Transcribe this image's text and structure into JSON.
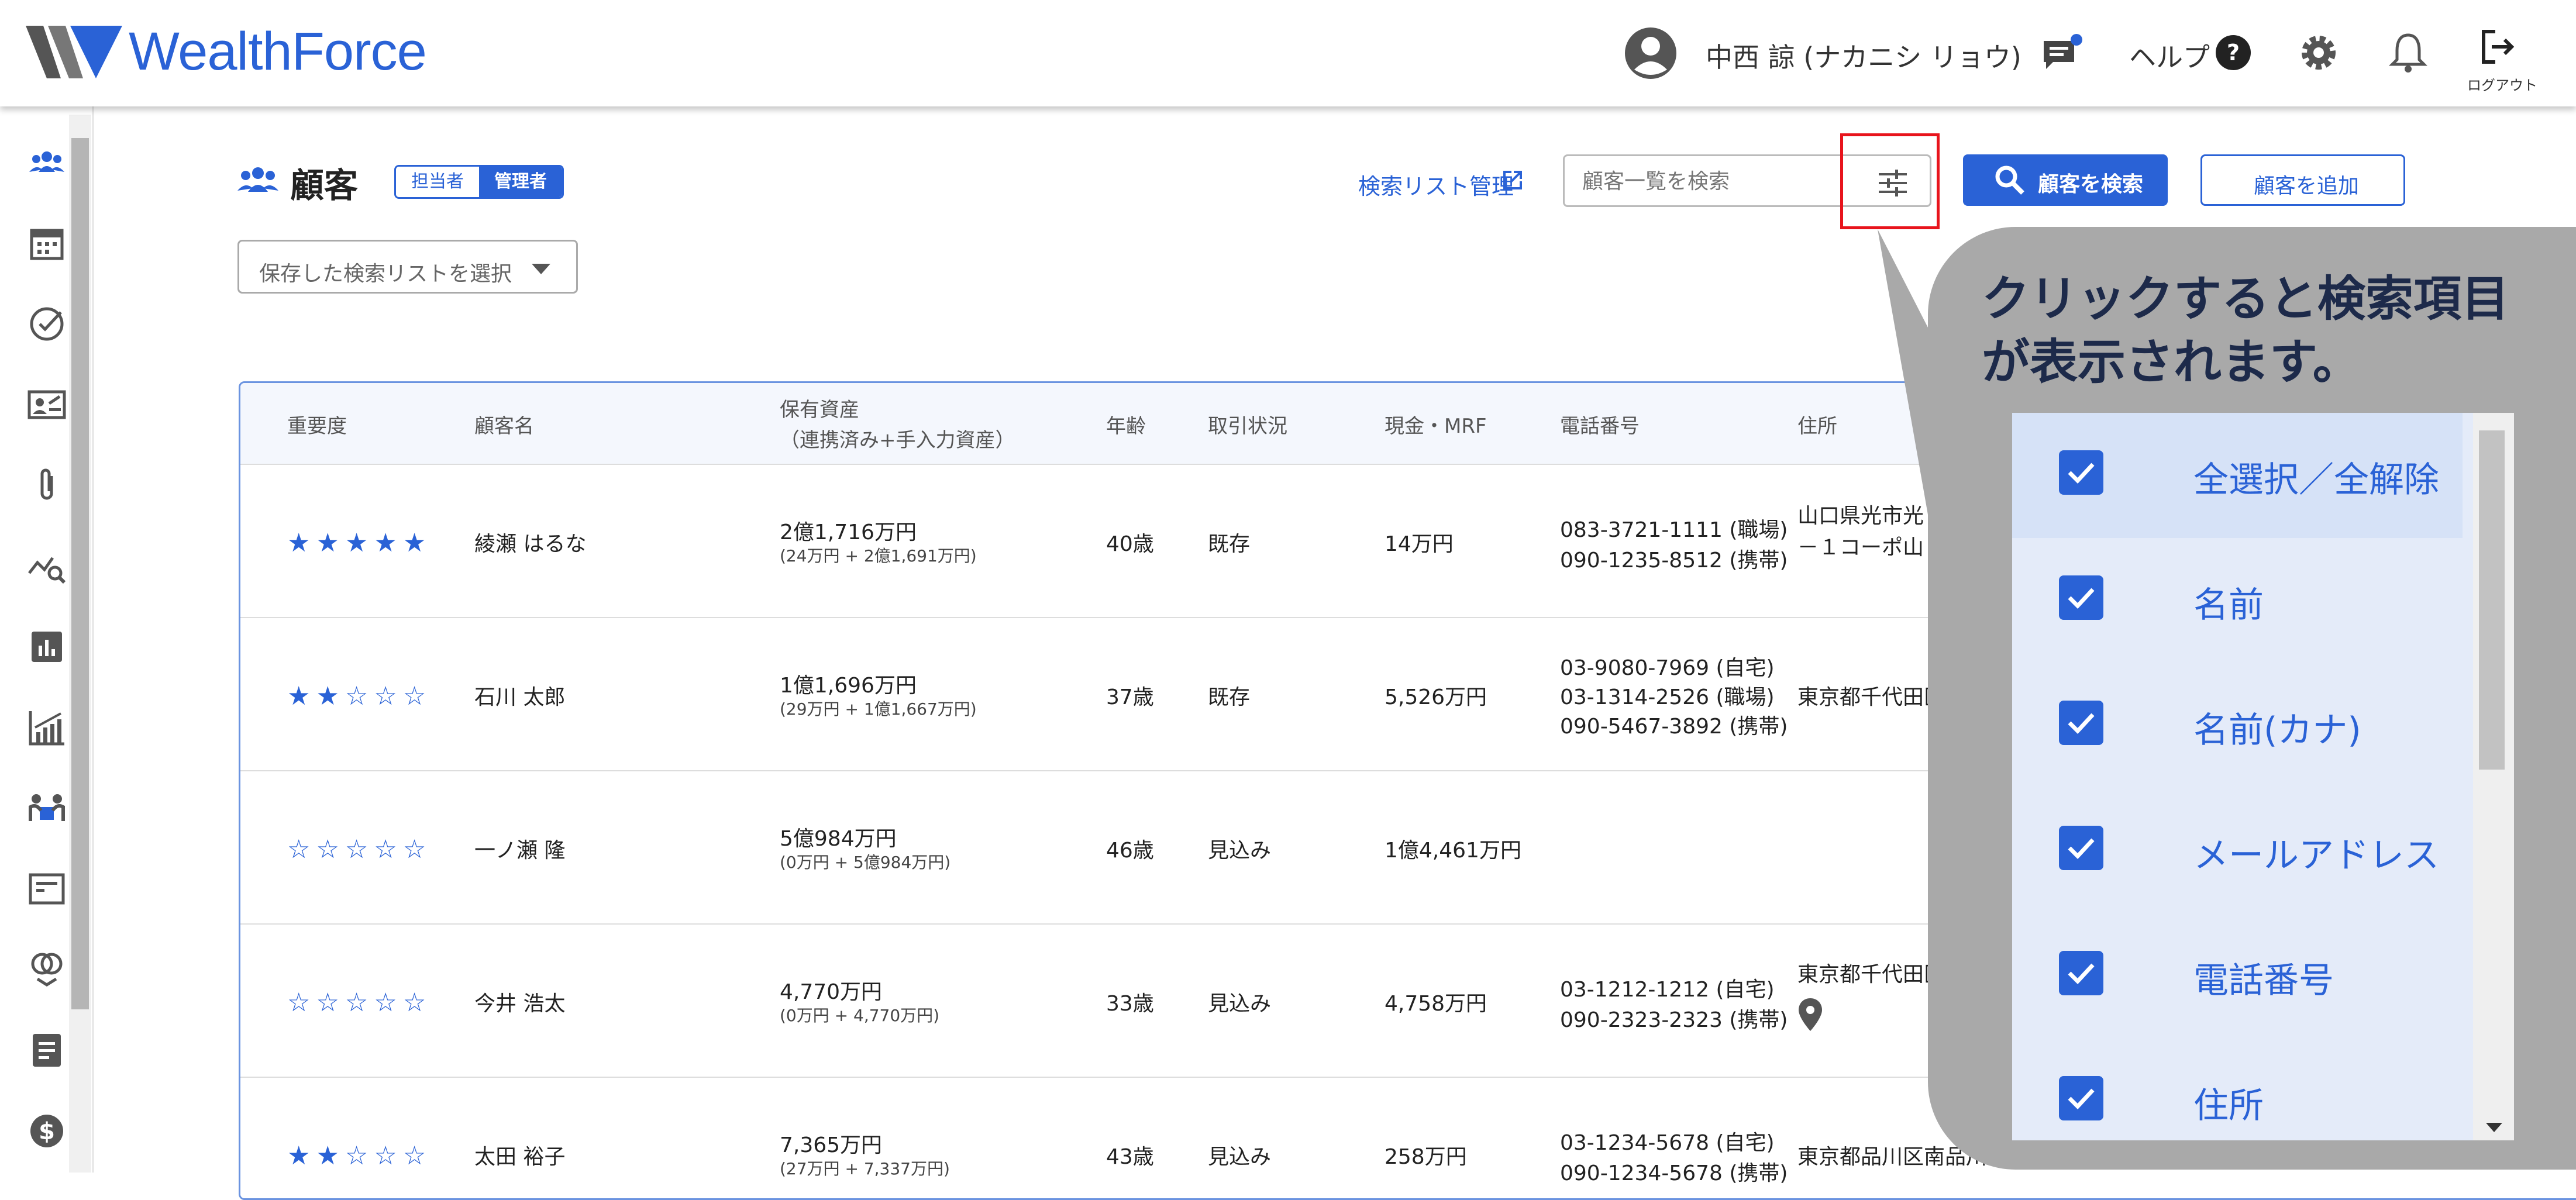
{
  "header": {
    "logo_text": "WealthForce",
    "user_name": "中西 諒 (ナカニシ リョウ)",
    "help_label": "ヘルプ",
    "logout_label": "ログアウト",
    "accent_color": "#2a62d6"
  },
  "sidebar": {
    "icons": [
      "customers-icon",
      "calendar-icon",
      "task-check-icon",
      "contact-card-icon",
      "attachment-icon",
      "analysis-icon",
      "report-chart-icon",
      "growth-chart-icon",
      "meeting-icon",
      "document-icon",
      "rings-icon",
      "notes-icon",
      "money-icon"
    ]
  },
  "main": {
    "title": "顧客",
    "role_toggle": [
      "担当者",
      "管理者"
    ],
    "saved_list_placeholder": "保存した検索リストを選択",
    "list_management_link": "検索リスト管理",
    "search_placeholder": "顧客一覧を検索",
    "search_button": "顧客を検索",
    "add_button": "顧客を追加"
  },
  "table": {
    "headers": [
      "重要度",
      "顧客名",
      "保有資産",
      "（連携済み+手入力資産）",
      "年齢",
      "取引状況",
      "現金・MRF",
      "電話番号",
      "住所"
    ],
    "rows": [
      {
        "stars": 5,
        "name": "綾瀬 はるな",
        "assets": "2億1,716万円",
        "assets_detail": "(24万円 + 2億1,691万円)",
        "age": "40歳",
        "status": "既存",
        "cash": "14万円",
        "phones": [
          "083-3721-1111 (職場)",
          "090-1235-8512 (携帯)"
        ],
        "address": [
          "山口県光市光",
          "－１コーポ山"
        ]
      },
      {
        "stars": 2,
        "name": "石川 太郎",
        "assets": "1億1,696万円",
        "assets_detail": "(29万円 + 1億1,667万円)",
        "age": "37歳",
        "status": "既存",
        "cash": "5,526万円",
        "phones": [
          "03-9080-7969 (自宅)",
          "03-1314-2526 (職場)",
          "090-5467-3892 (携帯)"
        ],
        "address": [
          "東京都千代田区"
        ]
      },
      {
        "stars": 0,
        "name": "一ノ瀬 隆",
        "assets": "5億984万円",
        "assets_detail": "(0万円 + 5億984万円)",
        "age": "46歳",
        "status": "見込み",
        "cash": "1億4,461万円",
        "phones": [],
        "address": []
      },
      {
        "stars": 0,
        "name": "今井 浩太",
        "assets": "4,770万円",
        "assets_detail": "(0万円 + 4,770万円)",
        "age": "33歳",
        "status": "見込み",
        "cash": "4,758万円",
        "phones": [
          "03-1212-1212 (自宅)",
          "090-2323-2323 (携帯)"
        ],
        "address": [
          "東京都千代田区"
        ]
      },
      {
        "stars": 2,
        "name": "太田 裕子",
        "assets": "7,365万円",
        "assets_detail": "(27万円 + 7,337万円)",
        "age": "43歳",
        "status": "見込み",
        "cash": "258万円",
        "phones": [
          "03-1234-5678 (自宅)",
          "090-1234-5678 (携帯)"
        ],
        "address": [
          "東京都品川区南品川"
        ]
      }
    ]
  },
  "callout": {
    "text_line1": "クリックすると検索項目",
    "text_line2": "が表示されます。",
    "options": [
      "全選択／全解除",
      "名前",
      "名前(カナ)",
      "メールアドレス",
      "電話番号",
      "住所"
    ]
  }
}
